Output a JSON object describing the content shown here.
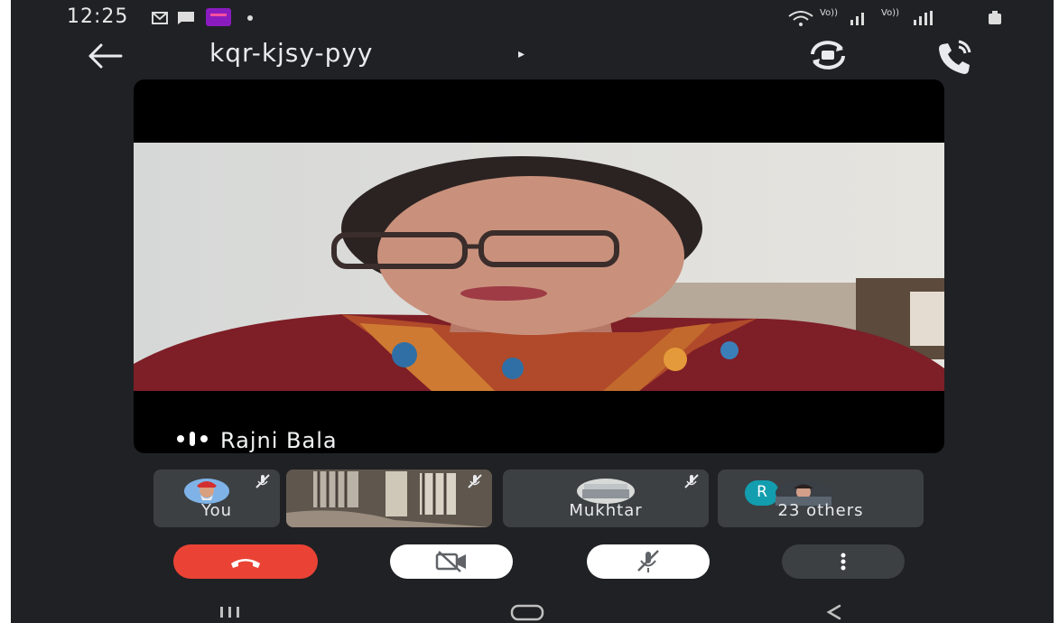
{
  "status_bar": {
    "time": "12:25",
    "icons": [
      "gmail-icon",
      "message-icon",
      "vi-app-icon",
      "dot-icon",
      "wifi-icon",
      "volte-signal-icon",
      "volte-signal-2-icon",
      "battery-icon"
    ],
    "network_label_1": "Vo))",
    "network_label_2": "Vo))"
  },
  "header": {
    "meeting_code": "kqr-kjsy-pyy",
    "caret_glyph": "▸",
    "back_icon": "arrow-left-icon",
    "switch_camera_icon": "camera-switch-icon",
    "audio_icon": "phone-speaker-icon"
  },
  "main_video": {
    "speaker_name": "Rajni Bala",
    "audio_indicator_icon": "audio-level-icon"
  },
  "participants": [
    {
      "name": "You",
      "avatar_icon": "user-avatar-icon",
      "muted": true
    },
    {
      "name": "",
      "avatar_icon": "video-thumbnail",
      "muted": true
    },
    {
      "name": "Mukhtar",
      "avatar_icon": "user-avatar-icon",
      "muted": true
    },
    {
      "name": "23 others",
      "avatar_letter": "R",
      "muted": false
    }
  ],
  "controls": {
    "end_call_icon": "hang-up-icon",
    "camera_icon": "camera-off-icon",
    "mic_icon": "mic-off-icon",
    "more_icon": "more-vert-icon"
  },
  "nav_bar": {
    "recents_icon": "recents-icon",
    "home_icon": "home-icon",
    "back_icon": "back-chevron-icon"
  },
  "colors": {
    "background": "#202124",
    "end_call_red": "#ea4335",
    "control_white": "#ffffff",
    "control_dark": "#3c4043",
    "tile_bg": "#3c4043",
    "avatar_teal": "#129eaf"
  }
}
